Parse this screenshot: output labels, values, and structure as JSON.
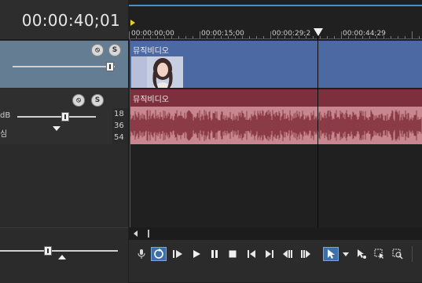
{
  "timeline": {
    "timecode": "00:00:40;01",
    "ruler_labels": [
      "00:00:00;00",
      "00:00:15;00",
      "00:00:29;2",
      "00:00:44;29"
    ]
  },
  "tracks": {
    "video": {
      "clip_title": "뮤직비디오"
    },
    "audio": {
      "clip_title": "뮤직비디오",
      "db_labels": [
        "18",
        "36",
        "54"
      ]
    }
  },
  "audio_header": {
    "volume_label_partial": "dB",
    "pan_label_partial": "심"
  },
  "colors": {
    "video_track": "#4c69a4",
    "audio_track": "#7e2f3d",
    "audio_wave": "#c8878e",
    "accent": "#4a8fc7"
  },
  "transport_icons": [
    "mic-icon",
    "loop-icon",
    "play-from-start-icon",
    "play-icon",
    "pause-icon",
    "stop-icon",
    "prev-frame-icon",
    "next-frame-icon",
    "go-start-icon",
    "go-end-icon",
    "normal-edit-tool-icon",
    "envelope-tool-icon",
    "selection-tool-icon",
    "zoom-tool-icon"
  ]
}
